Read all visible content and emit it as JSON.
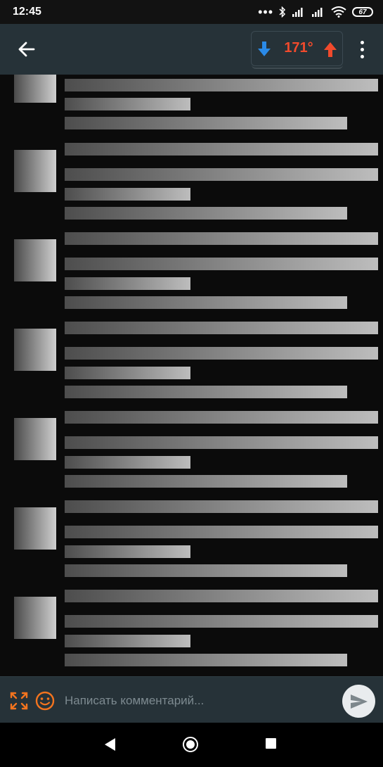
{
  "status_bar": {
    "time": "12:45",
    "dots": "•••",
    "battery": "67",
    "icons": [
      "bluetooth-icon",
      "signal-icon",
      "signal-icon",
      "wifi-icon",
      "battery-icon"
    ]
  },
  "app_bar": {
    "back_icon": "arrow-left-icon",
    "rating": {
      "value": "171°",
      "down_icon": "arrow-down-icon",
      "up_icon": "arrow-up-icon",
      "value_color": "#f14a2c",
      "down_color": "#2a8ae8",
      "up_color": "#f14a2c"
    },
    "menu_icon": "more-vert-icon"
  },
  "comment_input": {
    "placeholder": "Написать комментарий...",
    "value": "",
    "expand_icon": "expand-icon",
    "emoji_icon": "smiley-icon",
    "send_icon": "send-icon",
    "accent_color": "#f4741e"
  },
  "nav_bar": {
    "back_icon": "triangle-back-icon",
    "home_icon": "circle-home-icon",
    "recent_icon": "square-recent-icon"
  }
}
